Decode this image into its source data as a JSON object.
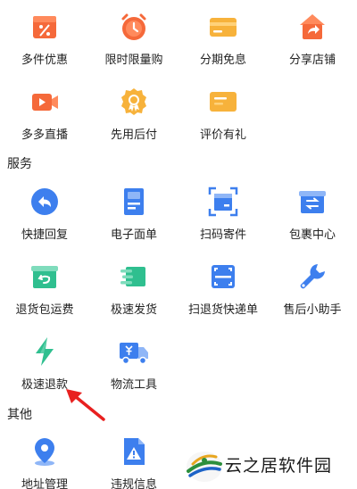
{
  "promo": {
    "items": [
      {
        "label": "多件优惠",
        "icon": "percent-tag-icon",
        "color": "#f5693a"
      },
      {
        "label": "限时限量购",
        "icon": "alarm-clock-icon",
        "color": "#f5693a"
      },
      {
        "label": "分期免息",
        "icon": "credit-card-icon",
        "color": "#f7b23b"
      },
      {
        "label": "分享店铺",
        "icon": "share-store-icon",
        "color": "#f5693a"
      },
      {
        "label": "多多直播",
        "icon": "video-camera-icon",
        "color": "#f5693a"
      },
      {
        "label": "先用后付",
        "icon": "badge-check-icon",
        "color": "#f7b23b"
      },
      {
        "label": "评价有礼",
        "icon": "review-card-icon",
        "color": "#f7b23b"
      }
    ]
  },
  "services": {
    "title": "服务",
    "items": [
      {
        "label": "快捷回复",
        "icon": "quick-reply-icon",
        "color": "#3d7fee"
      },
      {
        "label": "电子面单",
        "icon": "e-waybill-icon",
        "color": "#3d7fee"
      },
      {
        "label": "扫码寄件",
        "icon": "scan-package-icon",
        "color": "#3d7fee"
      },
      {
        "label": "包裹中心",
        "icon": "parcel-center-icon",
        "color": "#3d7fee"
      },
      {
        "label": "退货包运费",
        "icon": "return-shipping-icon",
        "color": "#2fbf8f"
      },
      {
        "label": "极速发货",
        "icon": "fast-delivery-icon",
        "color": "#2fbf8f"
      },
      {
        "label": "扫退货快递单",
        "icon": "scan-return-icon",
        "color": "#3d7fee"
      },
      {
        "label": "售后小助手",
        "icon": "wrench-icon",
        "color": "#3d7fee"
      },
      {
        "label": "极速退款",
        "icon": "lightning-icon",
        "color": "#2fbf8f"
      },
      {
        "label": "物流工具",
        "icon": "logistics-truck-icon",
        "color": "#3d7fee"
      }
    ]
  },
  "other": {
    "title": "其他",
    "items": [
      {
        "label": "地址管理",
        "icon": "location-pin-icon",
        "color": "#3d7fee"
      },
      {
        "label": "违规信息",
        "icon": "warning-document-icon",
        "color": "#3d7fee"
      }
    ]
  },
  "watermark": {
    "text": "云之居软件园"
  },
  "annotation": {
    "arrow_color": "#e8201f"
  }
}
